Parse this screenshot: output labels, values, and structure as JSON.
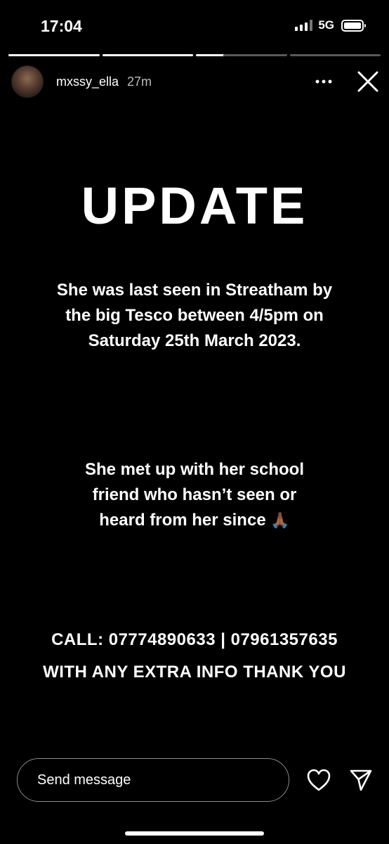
{
  "status_bar": {
    "time": "17:04",
    "network": "5G"
  },
  "progress": {
    "segments": [
      1,
      1,
      0.3,
      0
    ]
  },
  "story": {
    "username": "mxssy_ella",
    "elapsed": "27m"
  },
  "content": {
    "title": "UPDATE",
    "para1": [
      "She was last seen in Streatham by",
      "the big Tesco between 4/5pm on",
      "Saturday 25th March 2023."
    ],
    "para2": [
      "She met up with her school",
      "friend who hasn’t seen or",
      "heard from her since"
    ],
    "pray_emoji": "🙏🏾",
    "call_line1": "CALL: 07774890633 | 07961357635",
    "call_line2": "WITH ANY EXTRA INFO THANK YOU"
  },
  "footer": {
    "placeholder": "Send message"
  },
  "icons": [
    "signal-icon",
    "battery-icon",
    "more-icon",
    "close-icon",
    "heart-icon",
    "share-icon"
  ]
}
